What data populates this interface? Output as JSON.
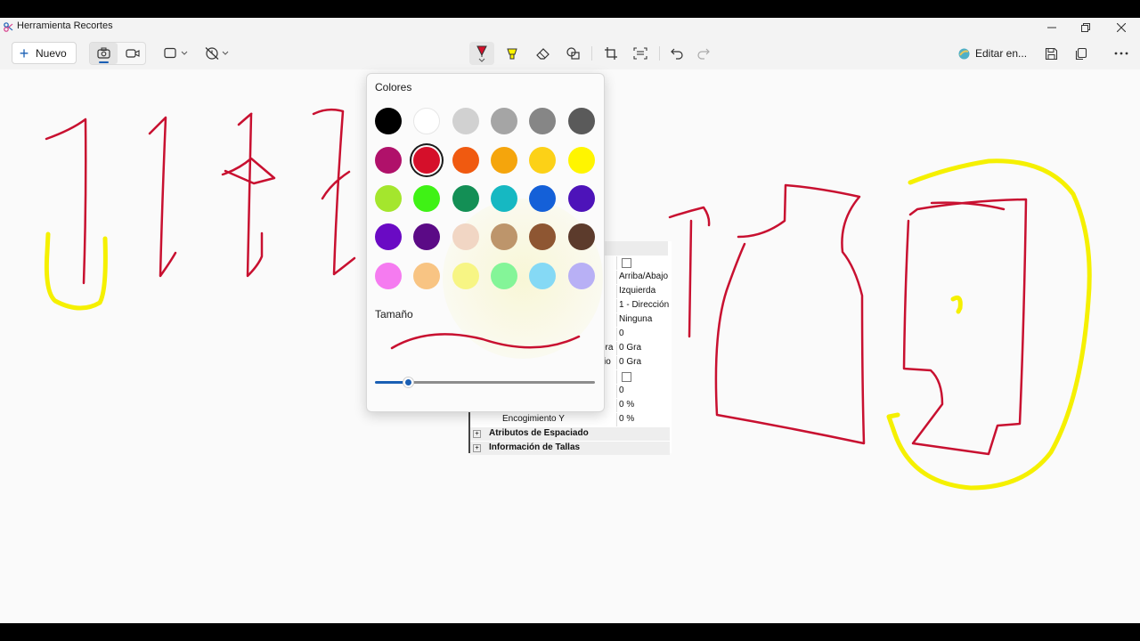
{
  "window": {
    "title": "Herramienta Recortes",
    "controls": {
      "minimize": "minimize-icon",
      "restore": "restore-icon",
      "close": "close-icon"
    }
  },
  "toolbar": {
    "nuevo_label": "Nuevo",
    "editar_label": "Editar en...",
    "modes": [
      "camera-icon",
      "video-icon"
    ],
    "tools": [
      "snip-shape-icon",
      "delay-icon",
      "pen-icon",
      "highlighter-icon",
      "eraser-icon",
      "shapes-icon",
      "crop-icon",
      "text-actions-icon",
      "undo-icon",
      "redo-icon",
      "save-icon",
      "copy-icon",
      "more-icon"
    ]
  },
  "pen_popup": {
    "colors_label": "Colores",
    "size_label": "Tamaño",
    "colors": [
      [
        "#000000",
        "#ffffff",
        "#d1d1d1",
        "#a5a5a5",
        "#868686",
        "#5a5a5a"
      ],
      [
        "#b0116a",
        "#d50f2a",
        "#f05a10",
        "#f5a50c",
        "#fcd117",
        "#fff500"
      ],
      [
        "#a4e62d",
        "#3ff215",
        "#138f55",
        "#16b8c2",
        "#1460d8",
        "#4d13b9"
      ],
      [
        "#6a0ac4",
        "#5b0a86",
        "#f1d6c4",
        "#bd956b",
        "#8e5632",
        "#5c3b2c"
      ],
      [
        "#f57bf0",
        "#f8c483",
        "#f7f584",
        "#84f598",
        "#85d9f5",
        "#b8b0f5"
      ]
    ],
    "selected_color": "#d50f2a",
    "size_value": 0.15
  },
  "properties_panel": {
    "rows": [
      {
        "name": "",
        "value": "",
        "type": "checkbox"
      },
      {
        "name": "",
        "value": "Arriba/Abajo"
      },
      {
        "name": "",
        "value": "Izquierda"
      },
      {
        "name": "",
        "value": "1 - Dirección"
      },
      {
        "name": "",
        "value": "Ninguna"
      },
      {
        "name": "",
        "value": "0"
      },
      {
        "name": "ora",
        "value": "0 Gra"
      },
      {
        "name": "io",
        "value": "0 Gra"
      },
      {
        "name": "",
        "value": "",
        "type": "checkbox"
      },
      {
        "name": "",
        "value": "0"
      },
      {
        "name": "",
        "value": "0 %"
      },
      {
        "name": "Encogimiento Y",
        "value": "0 %"
      }
    ],
    "groups": [
      "Atributos de Espaciado",
      "Información de Tallas"
    ]
  }
}
